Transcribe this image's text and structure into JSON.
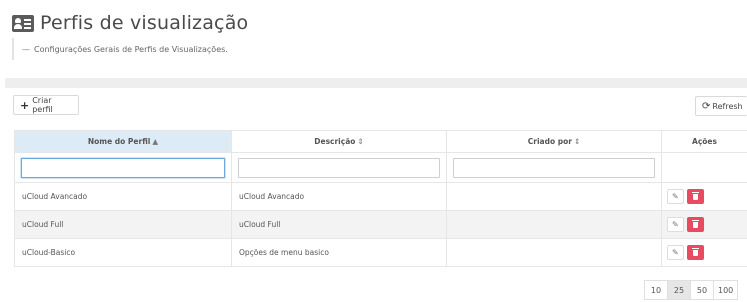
{
  "page": {
    "title": "Perfis de visualização",
    "subtitle_dash": "—",
    "subtitle": "Configurações Gerais de Perfis de Visualizações."
  },
  "toolbar": {
    "create_label": "Criar perfil",
    "refresh_label": "Refresh",
    "create_icon": "plus-icon",
    "refresh_icon": "refresh-icon"
  },
  "table": {
    "columns": [
      {
        "label": "Nome do Perfil",
        "sort": "▲"
      },
      {
        "label": "Descrição",
        "sort": "⇕"
      },
      {
        "label": "Criado por",
        "sort": "⇕"
      },
      {
        "label": "Ações",
        "sort": ""
      }
    ],
    "filters": {
      "name": "",
      "description": "",
      "created_by": ""
    },
    "rows": [
      {
        "name": "uCloud Avancado",
        "description": "uCloud Avancado",
        "created_by": ""
      },
      {
        "name": "uCloud Full",
        "description": "uCloud Full",
        "created_by": ""
      },
      {
        "name": "uCloud-Basico",
        "description": "Opções de menu basico",
        "created_by": ""
      }
    ],
    "row_action_icons": [
      "edit-icon",
      "trash-icon"
    ]
  },
  "pagination": {
    "page_sizes": [
      "10",
      "25",
      "50",
      "100"
    ],
    "selected": "25"
  },
  "colors": {
    "sorted_header": "#dcebf6",
    "delete_button": "#e84a5f",
    "focus_border": "#6fa8dc"
  }
}
